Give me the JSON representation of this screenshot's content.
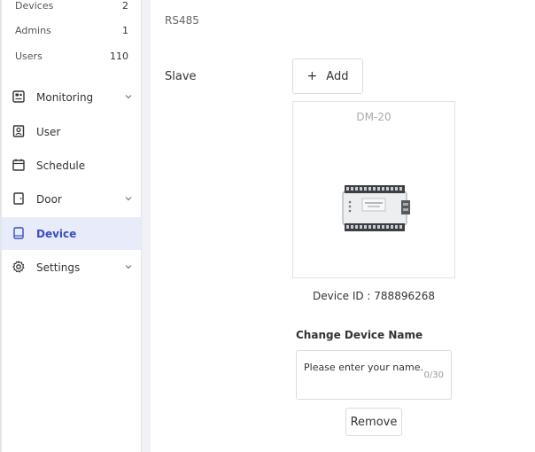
{
  "stats": [
    {
      "label": "Devices",
      "value": "2"
    },
    {
      "label": "Admins",
      "value": "1"
    },
    {
      "label": "Users",
      "value": "110"
    }
  ],
  "nav": {
    "monitoring": "Monitoring",
    "user": "User",
    "schedule": "Schedule",
    "door": "Door",
    "device": "Device",
    "settings": "Settings"
  },
  "main": {
    "section_label": "RS485",
    "slave_label": "Slave",
    "add_button": "Add",
    "add_icon": "+",
    "device_card_title": "DM-20",
    "device_id_text": "Device ID : 788896268",
    "change_name_title": "Change Device Name",
    "name_placeholder": "Please enter your name.",
    "name_counter": "0/30",
    "remove_button": "Remove"
  },
  "colors": {
    "active_nav_bg": "#e8ebfa",
    "active_nav_text": "#3a4ec2"
  }
}
